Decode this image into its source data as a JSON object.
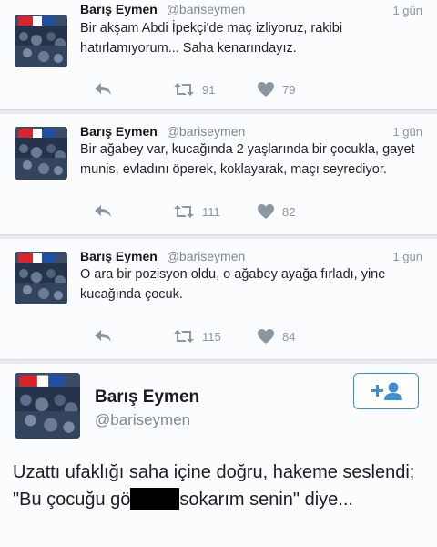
{
  "tweets": [
    {
      "name": "Barış Eymen",
      "handle": "@bariseymen",
      "time": "1 gün",
      "text": "Bir akşam Abdi İpekçi'de maç izliyoruz, rakibi hatırlamıyorum... Saha kenarındayız.",
      "retweets": "91",
      "likes": "79"
    },
    {
      "name": "Barış Eymen",
      "handle": "@bariseymen",
      "time": "1 gün",
      "text": "Bir ağabey var, kucağında 2 yaşlarında bir çocukla, gayet munis, evladını öperek, koklayarak, maçı seyrediyor.",
      "retweets": "111",
      "likes": "82"
    },
    {
      "name": "Barış Eymen",
      "handle": "@bariseymen",
      "time": "1 gün",
      "text": "O ara bir pozisyon oldu, o ağabey ayağa fırladı, yine kucağında çocuk.",
      "retweets": "115",
      "likes": "84"
    }
  ],
  "featured": {
    "name": "Barış Eymen",
    "handle": "@bariseymen",
    "text_before": "Uzattı ufaklığı saha içine doğru, hakeme seslendi; \"Bu çocuğu gö",
    "text_after": "sokarım senin\" diye..."
  },
  "icons": {
    "reply": "reply-arrow-icon",
    "retweet": "retweet-icon",
    "like": "heart-icon",
    "follow": "follow-person-plus-icon"
  },
  "colors": {
    "accent": "#3d8fd0",
    "muted": "#8a96a1",
    "background": "#fbfcfd"
  }
}
